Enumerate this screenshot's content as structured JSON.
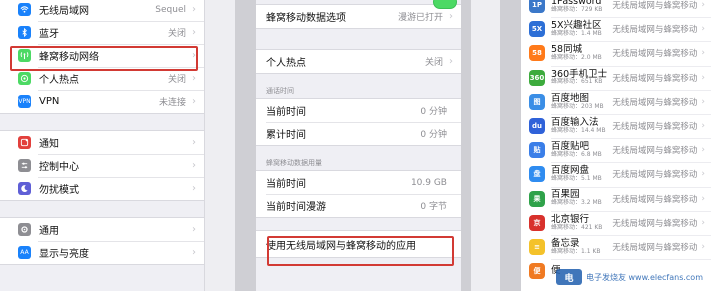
{
  "left": {
    "group1": [
      {
        "label": "无线局域网",
        "value": "Sequel",
        "icon": "wifi-icon",
        "color": "#1a82fb"
      },
      {
        "label": "蓝牙",
        "value": "关闭",
        "icon": "bluetooth-icon",
        "color": "#1a82fb"
      },
      {
        "label": "蜂窝移动网络",
        "value": "",
        "icon": "antenna-icon",
        "color": "#4cd964"
      },
      {
        "label": "个人热点",
        "value": "关闭",
        "icon": "hotspot-icon",
        "color": "#4cd964"
      },
      {
        "label": "VPN",
        "value": "未连接",
        "icon": "vpn-icon",
        "color": "#1a82fb"
      }
    ],
    "group2": [
      {
        "label": "通知",
        "icon": "notification-icon",
        "color": "#e2403c"
      },
      {
        "label": "控制中心",
        "icon": "control-center-icon",
        "color": "#8e8e93"
      },
      {
        "label": "勿扰模式",
        "icon": "moon-icon",
        "color": "#5f5fd6"
      }
    ],
    "group3": [
      {
        "label": "通用",
        "icon": "gear-icon",
        "color": "#8e8e93"
      },
      {
        "label": "显示与亮度",
        "icon": "brightness-icon",
        "color": "#1a82fb"
      }
    ]
  },
  "middle": {
    "cellular_data_options": {
      "label": "蜂窝移动数据选项",
      "value": "漫游已打开"
    },
    "personal_hotspot": {
      "label": "个人热点",
      "value": "关闭"
    },
    "call_time_header": "通话时间",
    "current_period": {
      "label": "当前时间",
      "value": "0 分钟"
    },
    "lifetime": {
      "label": "累计时间",
      "value": "0 分钟"
    },
    "cellular_data_usage_header": "蜂窝移动数据用量",
    "current_usage": {
      "label": "当前时间",
      "value": "10.9 GB"
    },
    "roaming_usage": {
      "label": "当前时间漫游",
      "value": "0 字节"
    },
    "wlan_apps": {
      "label": "使用无线局域网与蜂窝移动的应用"
    }
  },
  "right": {
    "apps": [
      {
        "name": "1Password",
        "usage": "蜂窝移动：729 KB",
        "setting": "无线局域网与蜂窝移动",
        "color": "#3b78c9",
        "glyph": "1P"
      },
      {
        "name": "5X兴趣社区",
        "usage": "蜂窝移动：1.4 MB",
        "setting": "无线局域网与蜂窝移动",
        "color": "#2d6fd6",
        "glyph": "5X"
      },
      {
        "name": "58同城",
        "usage": "蜂窝移动：2.0 MB",
        "setting": "无线局域网与蜂窝移动",
        "color": "#ff7a1a",
        "glyph": "58"
      },
      {
        "name": "360手机卫士",
        "usage": "蜂窝移动：651 KB",
        "setting": "无线局域网与蜂窝移动",
        "color": "#3dab3d",
        "glyph": "360"
      },
      {
        "name": "百度地图",
        "usage": "蜂窝移动：203 MB",
        "setting": "无线局域网与蜂窝移动",
        "color": "#3a8ee6",
        "glyph": "图"
      },
      {
        "name": "百度输入法",
        "usage": "蜂窝移动：14.4 MB",
        "setting": "无线局域网与蜂窝移动",
        "color": "#2f62d9",
        "glyph": "du"
      },
      {
        "name": "百度贴吧",
        "usage": "蜂窝移动：6.8 MB",
        "setting": "无线局域网与蜂窝移动",
        "color": "#3a7ee8",
        "glyph": "贴"
      },
      {
        "name": "百度网盘",
        "usage": "蜂窝移动：5.1 MB",
        "setting": "无线局域网与蜂窝移动",
        "color": "#2f8cf0",
        "glyph": "盘"
      },
      {
        "name": "百果园",
        "usage": "蜂窝移动：3.2 MB",
        "setting": "无线局域网与蜂窝移动",
        "color": "#2fa24a",
        "glyph": "果"
      },
      {
        "name": "北京银行",
        "usage": "蜂窝移动：421 KB",
        "setting": "无线局域网与蜂窝移动",
        "color": "#d8312c",
        "glyph": "京"
      },
      {
        "name": "备忘录",
        "usage": "蜂窝移动：1.1 KB",
        "setting": "无线局域网与蜂窝移动",
        "color": "#f4c22a",
        "glyph": "≡"
      },
      {
        "name": "便",
        "usage": "",
        "setting": "",
        "color": "#f07a22",
        "glyph": "便"
      }
    ]
  },
  "watermark": {
    "text": "电子发烧友 www.elecfans.com",
    "logo": "电"
  }
}
